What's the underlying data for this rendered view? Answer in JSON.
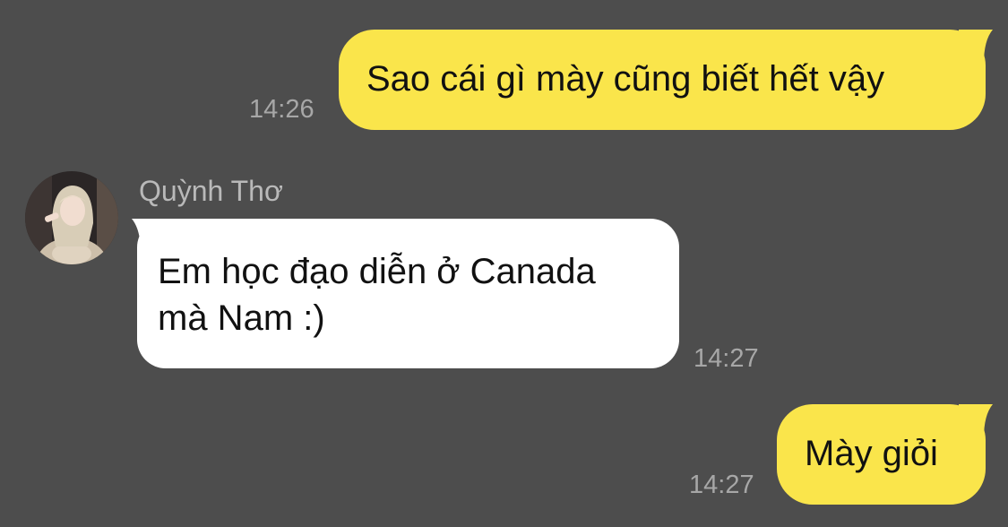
{
  "conversation": {
    "messages": [
      {
        "direction": "outgoing",
        "text": "Sao cái gì mày cũng biết hết vậy",
        "time": "14:26"
      },
      {
        "direction": "incoming",
        "sender": "Quỳnh Thơ",
        "text": "Em học đạo diễn ở Canada mà Nam :)",
        "time": "14:27"
      },
      {
        "direction": "outgoing",
        "text": "Mày giỏi",
        "time": "14:27"
      }
    ]
  },
  "colors": {
    "background": "#4d4d4d",
    "outgoing_bubble": "#fae54b",
    "incoming_bubble": "#ffffff",
    "timestamp": "#a7a7a7",
    "sender_name": "#b9b9b9"
  },
  "icons": {
    "avatar": "contact-avatar-photo"
  }
}
